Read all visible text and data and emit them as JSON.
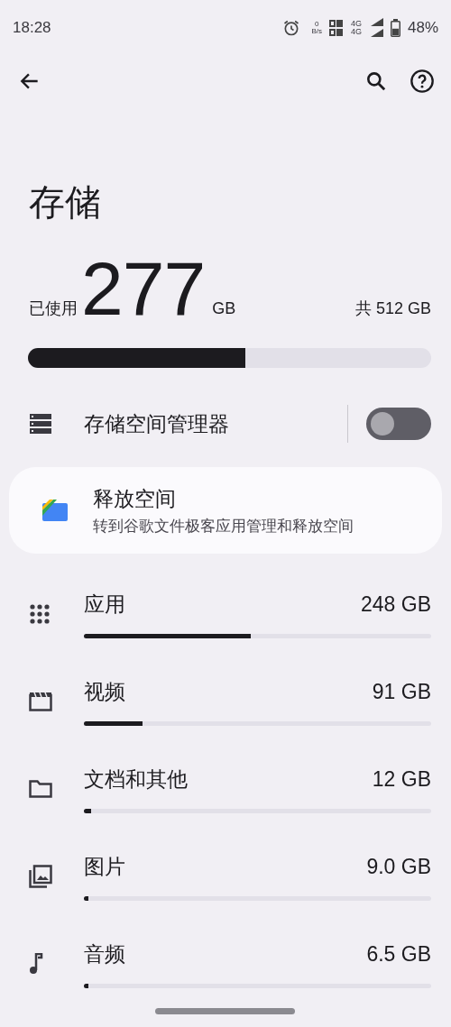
{
  "status_bar": {
    "time": "18:28",
    "net_speed": "0",
    "net_unit": "B/s",
    "network_1": "4G",
    "network_2": "4G",
    "battery": "48%"
  },
  "title": "存储",
  "usage": {
    "used_label": "已使用",
    "used": "277",
    "unit": "GB",
    "total": "共 512 GB",
    "level": 0.54
  },
  "manager": {
    "label": "存储空间管理器",
    "on": false
  },
  "free_up": {
    "title": "释放空间",
    "subtitle": "转到谷歌文件极客应用管理和释放空间"
  },
  "categories": [
    {
      "kind": "apps",
      "label": "应用",
      "size": "248 GB",
      "level": 0.48
    },
    {
      "kind": "video",
      "label": "视频",
      "size": "91 GB",
      "level": 0.17
    },
    {
      "kind": "docs",
      "label": "文档和其他",
      "size": "12 GB",
      "level": 0.02
    },
    {
      "kind": "images",
      "label": "图片",
      "size": "9.0 GB",
      "level": 0.01
    },
    {
      "kind": "audio",
      "label": "音频",
      "size": "6.5 GB",
      "level": 0.01
    }
  ]
}
